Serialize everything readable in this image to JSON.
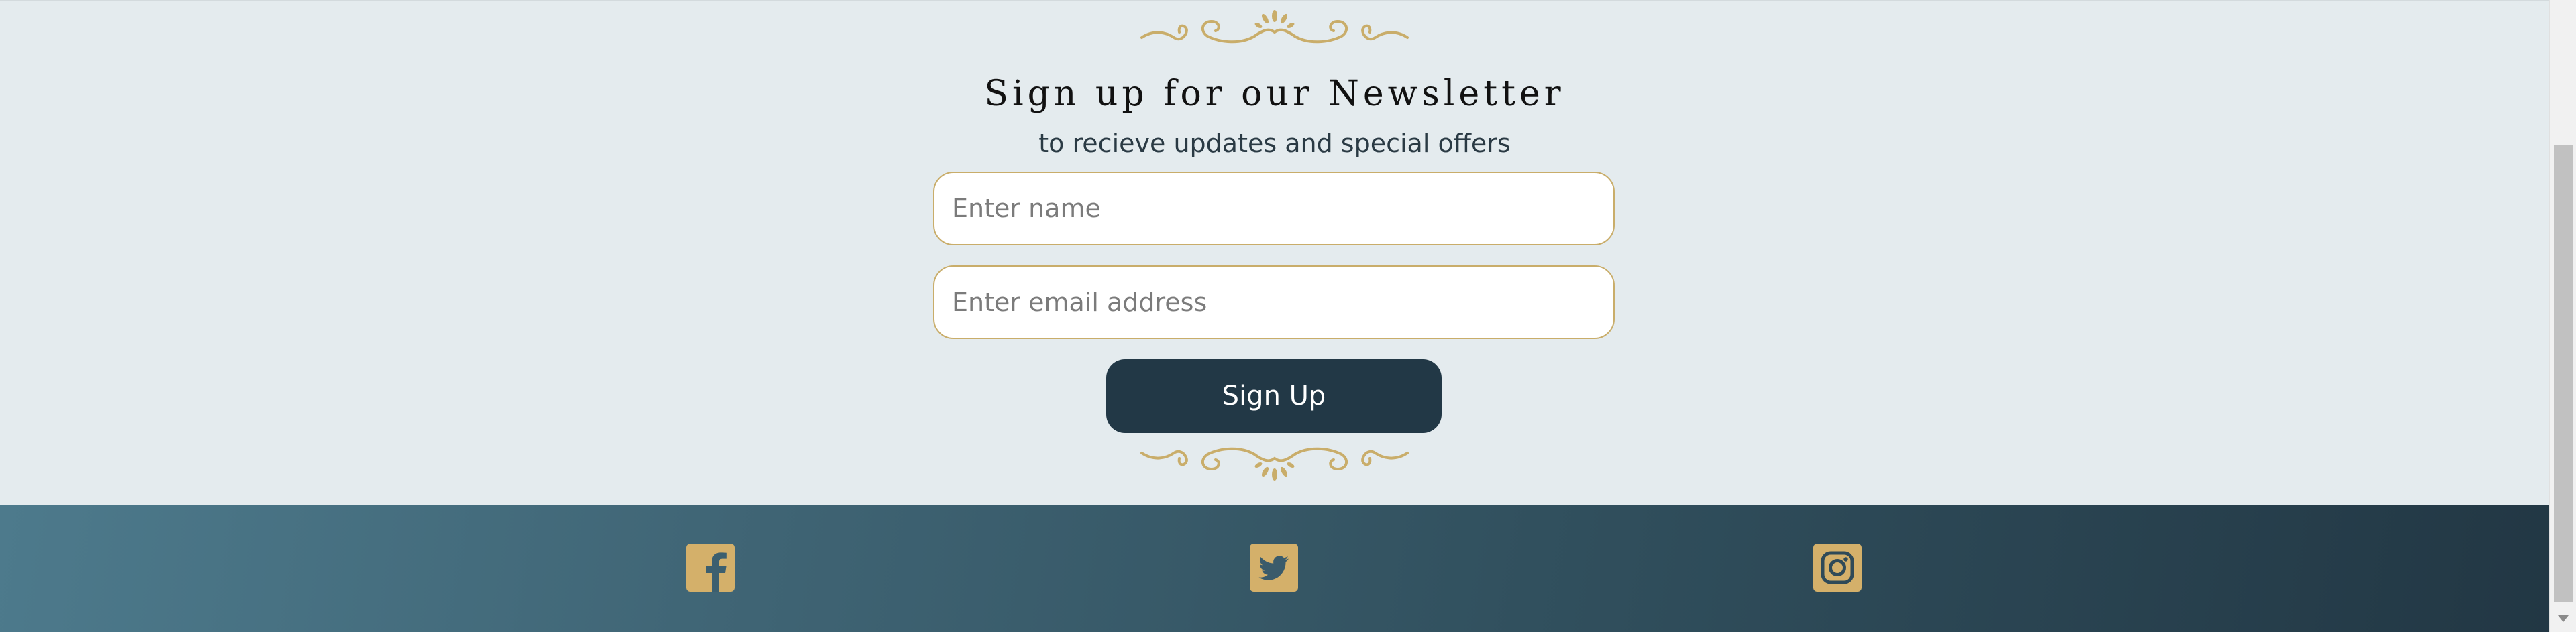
{
  "newsletter": {
    "title": "Sign up for our Newsletter",
    "subtitle": "to recieve updates and special offers",
    "name_field": {
      "placeholder": "Enter name",
      "value": ""
    },
    "email_field": {
      "placeholder": "Enter email address",
      "value": ""
    },
    "submit_label": "Sign Up",
    "ornament_icon": "flourish-divider-icon"
  },
  "footer": {
    "social_links": [
      {
        "icon": "facebook-icon"
      },
      {
        "icon": "twitter-icon"
      },
      {
        "icon": "instagram-icon"
      }
    ]
  },
  "colors": {
    "section_background": "#e4ebee",
    "accent_gold": "#c9ad6a",
    "button_navy": "#223846",
    "footer_gradient_start": "#4d7a8c",
    "footer_gradient_end": "#223744"
  }
}
